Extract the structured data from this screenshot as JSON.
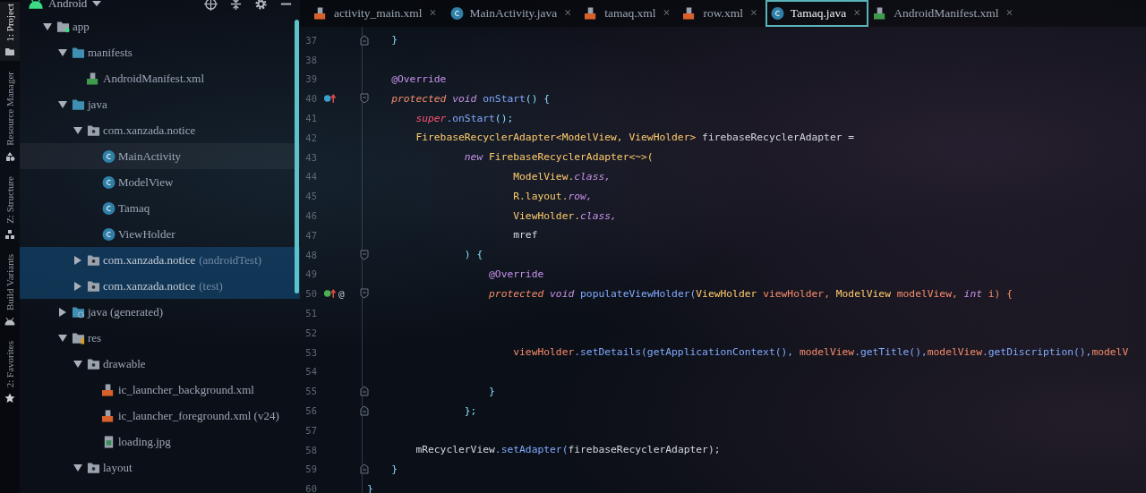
{
  "tool_strip": [
    {
      "label": "1: Project",
      "kind": "folder",
      "selected": true
    },
    {
      "label": "Resource Manager",
      "kind": "shapes",
      "selected": false
    },
    {
      "label": "Z: Structure",
      "kind": "structure",
      "selected": false
    },
    {
      "label": "Build Variants",
      "kind": "android",
      "selected": false
    },
    {
      "label": "2: Favorites",
      "kind": "star",
      "selected": false
    }
  ],
  "project": {
    "view": "Android",
    "tree": [
      {
        "name": "app",
        "kind": "module",
        "expanded": true,
        "selected": false,
        "hovered": false,
        "children": [
          {
            "name": "manifests",
            "kind": "folder",
            "expanded": true,
            "selected": false,
            "hovered": false,
            "children": [
              {
                "name": "AndroidManifest.xml",
                "kind": "manifest",
                "selected": false,
                "hovered": false
              }
            ]
          },
          {
            "name": "java",
            "kind": "folder",
            "expanded": true,
            "selected": false,
            "hovered": false,
            "children": [
              {
                "name": "com.xanzada.notice",
                "kind": "package",
                "expanded": true,
                "selected": false,
                "hovered": false,
                "children": [
                  {
                    "name": "MainActivity",
                    "kind": "class",
                    "selected": false,
                    "hovered": true
                  },
                  {
                    "name": "ModelView",
                    "kind": "class",
                    "selected": false,
                    "hovered": false
                  },
                  {
                    "name": "Tamaq",
                    "kind": "class",
                    "selected": false,
                    "hovered": false
                  },
                  {
                    "name": "ViewHolder",
                    "kind": "class",
                    "selected": false,
                    "hovered": false
                  }
                ]
              },
              {
                "name": "com.xanzada.notice",
                "suffix": "(androidTest)",
                "kind": "package",
                "expanded": false,
                "selected": true,
                "hovered": false
              },
              {
                "name": "com.xanzada.notice",
                "suffix": "(test)",
                "kind": "package",
                "expanded": false,
                "selected": true,
                "hovered": false
              }
            ]
          },
          {
            "name": "java (generated)",
            "kind": "generated",
            "expanded": false,
            "selected": false,
            "hovered": false
          },
          {
            "name": "res",
            "kind": "res",
            "expanded": true,
            "selected": false,
            "hovered": false,
            "children": [
              {
                "name": "drawable",
                "kind": "package",
                "expanded": true,
                "selected": false,
                "hovered": false,
                "children": [
                  {
                    "name": "ic_launcher_background.xml",
                    "kind": "xml",
                    "selected": false,
                    "hovered": false
                  },
                  {
                    "name": "ic_launcher_foreground.xml (v24)",
                    "kind": "xml",
                    "selected": false,
                    "hovered": false
                  },
                  {
                    "name": "loading.jpg",
                    "kind": "image",
                    "selected": false,
                    "hovered": false
                  }
                ]
              },
              {
                "name": "layout",
                "kind": "package",
                "expanded": true,
                "selected": false,
                "hovered": false
              }
            ]
          }
        ]
      }
    ]
  },
  "tabs": [
    {
      "label": "activity_main.xml",
      "kind": "xml",
      "selected": false,
      "close": "×"
    },
    {
      "label": "MainActivity.java",
      "kind": "class",
      "selected": false,
      "close": "×"
    },
    {
      "label": "tamaq.xml",
      "kind": "xml",
      "selected": false,
      "close": "×"
    },
    {
      "label": "row.xml",
      "kind": "xml",
      "selected": false,
      "close": "×"
    },
    {
      "label": "Tamaq.java",
      "kind": "class",
      "selected": true,
      "close": "×"
    },
    {
      "label": "AndroidManifest.xml",
      "kind": "manifest",
      "selected": false,
      "close": "×"
    }
  ],
  "editor": {
    "lines": [
      {
        "number": "37",
        "fold": {
          "kind": "end"
        },
        "tokens": [
          {
            "text": "    }",
            "kind": "punct"
          }
        ]
      },
      {
        "number": "38"
      },
      {
        "number": "39",
        "tokens": [
          {
            "text": "    @Override",
            "kind": "annotation"
          }
        ]
      },
      {
        "number": "40",
        "marker": {
          "kind": "override"
        },
        "fold": {
          "kind": "start"
        },
        "tokens": [
          {
            "text": "    protected ",
            "kind": "modifier"
          },
          {
            "text": "void ",
            "kind": "keyword"
          },
          {
            "text": "onStart",
            "kind": "method"
          },
          {
            "text": "() {",
            "kind": "punct"
          }
        ]
      },
      {
        "number": "41",
        "tokens": [
          {
            "text": "        super",
            "kind": "super"
          },
          {
            "text": ".onStart",
            "kind": "method"
          },
          {
            "text": "();",
            "kind": "punct"
          }
        ]
      },
      {
        "number": "42",
        "tokens": [
          {
            "text": "        FirebaseRecyclerAdapter<ModelView, ViewHolder> ",
            "kind": "type"
          },
          {
            "text": "firebaseRecyclerAdapter =",
            "kind": "plain"
          }
        ]
      },
      {
        "number": "43",
        "tokens": [
          {
            "text": "                new ",
            "kind": "keyword"
          },
          {
            "text": "FirebaseRecyclerAdapter<~>(",
            "kind": "type"
          }
        ]
      },
      {
        "number": "44",
        "tokens": [
          {
            "text": "                        ModelView.",
            "kind": "type"
          },
          {
            "text": "class,",
            "kind": "field"
          }
        ]
      },
      {
        "number": "45",
        "tokens": [
          {
            "text": "                        R.layout.",
            "kind": "type"
          },
          {
            "text": "row,",
            "kind": "field"
          }
        ]
      },
      {
        "number": "46",
        "tokens": [
          {
            "text": "                        ViewHolder.",
            "kind": "type"
          },
          {
            "text": "class,",
            "kind": "field"
          }
        ]
      },
      {
        "number": "47",
        "tokens": [
          {
            "text": "                        mref",
            "kind": "plain"
          }
        ]
      },
      {
        "number": "48",
        "fold": {
          "kind": "start"
        },
        "tokens": [
          {
            "text": "                ) {",
            "kind": "punct"
          }
        ]
      },
      {
        "number": "49",
        "tokens": [
          {
            "text": "                    @Override",
            "kind": "annotation"
          }
        ]
      },
      {
        "number": "50",
        "marker": {
          "kind": "implement"
        },
        "gutter_mark": "@",
        "fold": {
          "kind": "start"
        },
        "tokens": [
          {
            "text": "                    protected ",
            "kind": "modifier"
          },
          {
            "text": "void ",
            "kind": "keyword"
          },
          {
            "text": "populateViewHolder(",
            "kind": "method"
          },
          {
            "text": "ViewHolder ",
            "kind": "type"
          },
          {
            "text": "viewHolder, ",
            "kind": "variable"
          },
          {
            "text": "ModelView ",
            "kind": "type"
          },
          {
            "text": "modelView, ",
            "kind": "variable"
          },
          {
            "text": "int ",
            "kind": "keyword"
          },
          {
            "text": "i) {",
            "kind": "variable"
          }
        ]
      },
      {
        "number": "51"
      },
      {
        "number": "52"
      },
      {
        "number": "53",
        "tokens": [
          {
            "text": "                        viewHolder",
            "kind": "variable"
          },
          {
            "text": ".setDetails(getApplicationContext(), ",
            "kind": "method"
          },
          {
            "text": "modelView",
            "kind": "variable"
          },
          {
            "text": ".getTitle(),",
            "kind": "method"
          },
          {
            "text": "modelView",
            "kind": "variable"
          },
          {
            "text": ".getDiscription(),",
            "kind": "method"
          },
          {
            "text": "modelV",
            "kind": "variable"
          }
        ]
      },
      {
        "number": "54"
      },
      {
        "number": "55",
        "fold": {
          "kind": "end"
        },
        "tokens": [
          {
            "text": "                    }",
            "kind": "punct"
          }
        ]
      },
      {
        "number": "56",
        "fold": {
          "kind": "end"
        },
        "tokens": [
          {
            "text": "                };",
            "kind": "punct"
          }
        ]
      },
      {
        "number": "57"
      },
      {
        "number": "58",
        "tokens": [
          {
            "text": "        mRecyclerView",
            "kind": "plain"
          },
          {
            "text": ".setAdapter(",
            "kind": "method"
          },
          {
            "text": "firebaseRecyclerAdapter);",
            "kind": "plain"
          }
        ]
      },
      {
        "number": "59",
        "fold": {
          "kind": "end"
        },
        "tokens": [
          {
            "text": "    }",
            "kind": "punct"
          }
        ]
      },
      {
        "number": "60",
        "tokens": [
          {
            "text": "}",
            "kind": "punct"
          }
        ]
      }
    ]
  }
}
